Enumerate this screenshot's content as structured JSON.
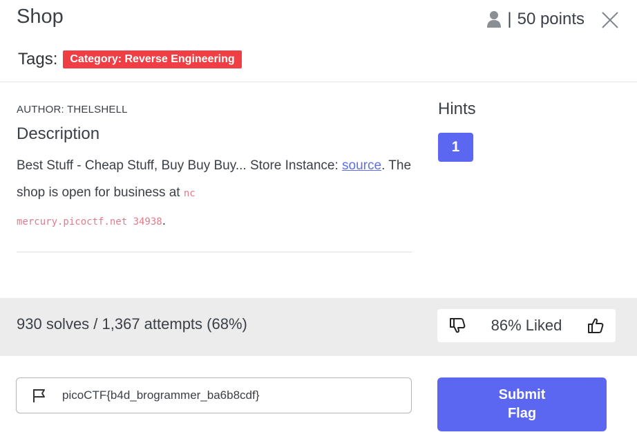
{
  "challenge": {
    "title": "Shop",
    "points_separator": "|",
    "points": "50 points"
  },
  "tags": {
    "label": "Tags:",
    "items": [
      "Category: Reverse Engineering"
    ]
  },
  "details": {
    "author": "AUTHOR: THELSHELL",
    "description_title": "Description",
    "description_part1": "Best Stuff - Cheap Stuff, Buy Buy Buy... Store Instance: ",
    "link_text": "source",
    "description_part2": ". The shop is open for business at ",
    "code_nc": "nc",
    "code_host": "mercury.picoctf.net 34938",
    "description_end": "."
  },
  "hints": {
    "title": "Hints",
    "items": [
      "1"
    ]
  },
  "stats": {
    "solves_text": "930 solves / 1,367 attempts (68%)",
    "liked_text": "86% Liked"
  },
  "flag": {
    "value": "picoCTF{b4d_brogrammer_ba6b8cdf}",
    "submit_line1": "Submit",
    "submit_line2": "Flag"
  },
  "colors": {
    "accent": "#5b67f0",
    "tag_red": "#ef3f44",
    "band_gray": "#ececec"
  }
}
